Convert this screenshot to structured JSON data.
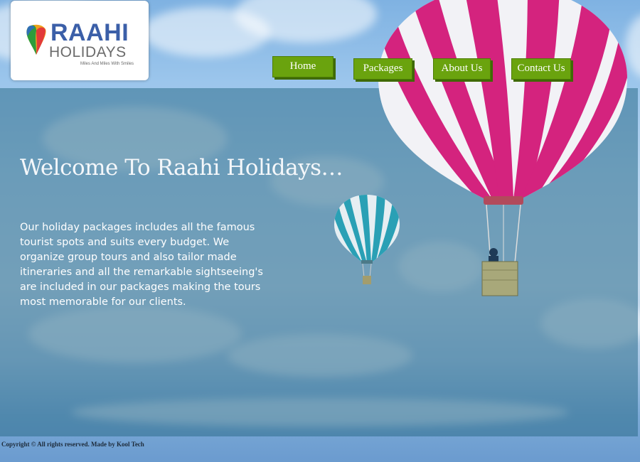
{
  "logo": {
    "title": "RAAHI",
    "subtitle": "HOLIDAYS",
    "tagline": "Miles And Miles With Smiles"
  },
  "nav": {
    "items": [
      {
        "label": "Home"
      },
      {
        "label": "Packages"
      },
      {
        "label": "About Us"
      },
      {
        "label": "Contact Us"
      }
    ]
  },
  "hero": {
    "heading": "Welcome To Raahi Holidays…",
    "body": "Our holiday packages includes all the famous tourist spots and suits every budget. We organize group tours and also tailor made itineraries and all the remarkable sightseeing's are included in our packages making the tours most memorable for our clients."
  },
  "footer": {
    "text": "Copyright © All rights reserved. Made by Kool Tech"
  },
  "colors": {
    "nav_button": "#6aa30e",
    "overlay": "#2e6e8c",
    "balloon_large": "#d4237e",
    "balloon_small": "#2aa0b5"
  },
  "icons": [
    "logo-balloon-mark-icon",
    "hot-air-balloon-large",
    "hot-air-balloon-small"
  ]
}
